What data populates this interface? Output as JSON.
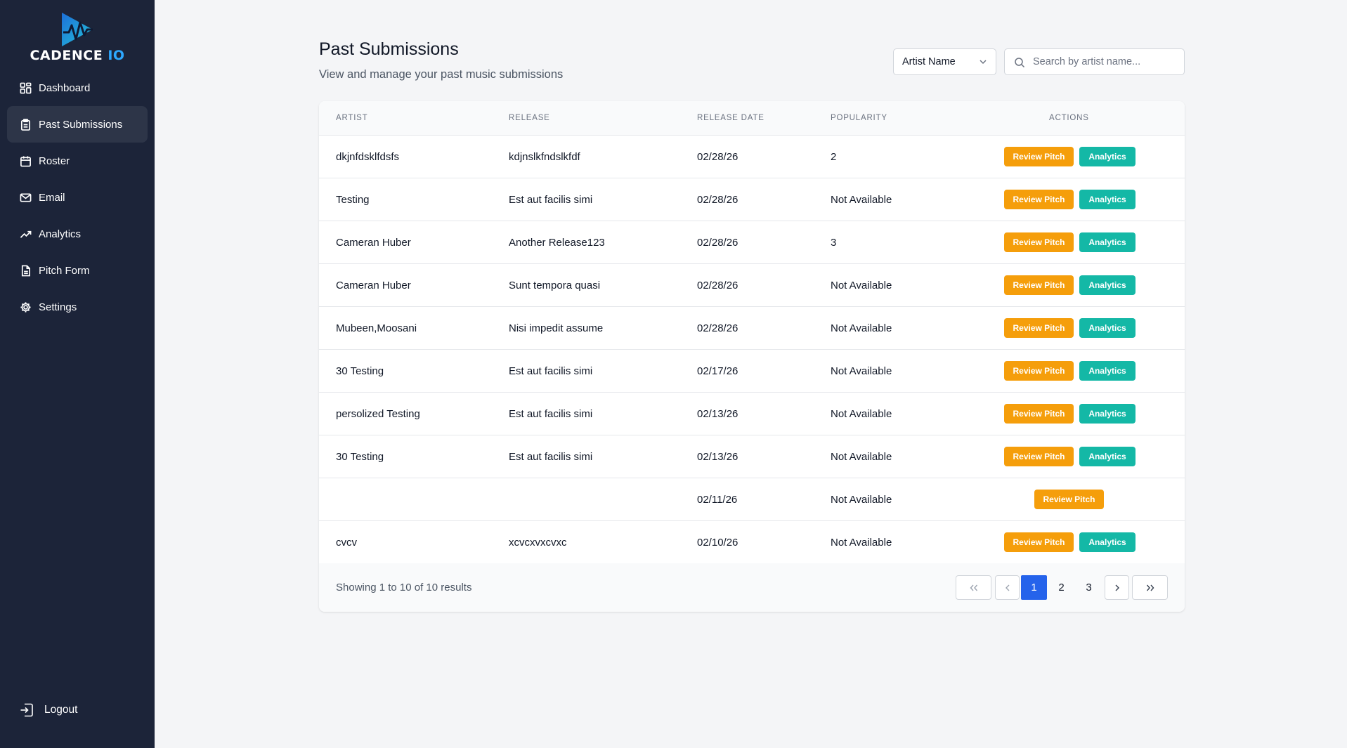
{
  "brand": {
    "name_main": "CADENCE",
    "name_suffix": "IO"
  },
  "sidebar": {
    "items": [
      {
        "label": "Dashboard",
        "icon": "dashboard-grid-icon",
        "active": false
      },
      {
        "label": "Past Submissions",
        "icon": "clipboard-icon",
        "active": true
      },
      {
        "label": "Roster",
        "icon": "calendar-icon",
        "active": false
      },
      {
        "label": "Email",
        "icon": "mail-icon",
        "active": false
      },
      {
        "label": "Analytics",
        "icon": "trending-up-icon",
        "active": false
      },
      {
        "label": "Pitch Form",
        "icon": "document-icon",
        "active": false
      },
      {
        "label": "Settings",
        "icon": "gear-icon",
        "active": false
      }
    ],
    "logout_label": "Logout"
  },
  "header": {
    "title": "Past Submissions",
    "subtitle": "View and manage your past music submissions"
  },
  "filters": {
    "field_select_value": "Artist Name",
    "search_placeholder": "Search by artist name..."
  },
  "table": {
    "columns": [
      "Artist",
      "Release",
      "Release Date",
      "Popularity",
      "Actions"
    ],
    "rows": [
      {
        "artist": "dkjnfdsklfdsfs",
        "release": "kdjnslkfndslkfdf",
        "date": "02/28/26",
        "popularity": "2",
        "review": "Review Pitch",
        "analytics": "Analytics"
      },
      {
        "artist": "Testing",
        "release": "Est aut facilis simi",
        "date": "02/28/26",
        "popularity": "Not Available",
        "review": "Review Pitch",
        "analytics": "Analytics"
      },
      {
        "artist": "Cameran Huber",
        "release": "Another Release123",
        "date": "02/28/26",
        "popularity": "3",
        "review": "Review Pitch",
        "analytics": "Analytics"
      },
      {
        "artist": "Cameran Huber",
        "release": "Sunt tempora quasi",
        "date": "02/28/26",
        "popularity": "Not Available",
        "review": "Review Pitch",
        "analytics": "Analytics"
      },
      {
        "artist": "Mubeen,Moosani",
        "release": "Nisi impedit assume",
        "date": "02/28/26",
        "popularity": "Not Available",
        "review": "Review Pitch",
        "analytics": "Analytics"
      },
      {
        "artist": "30 Testing",
        "release": "Est aut facilis simi",
        "date": "02/17/26",
        "popularity": "Not Available",
        "review": "Review Pitch",
        "analytics": "Analytics"
      },
      {
        "artist": "persolized Testing",
        "release": "Est aut facilis simi",
        "date": "02/13/26",
        "popularity": "Not Available",
        "review": "Review Pitch",
        "analytics": "Analytics"
      },
      {
        "artist": "30 Testing",
        "release": "Est aut facilis simi",
        "date": "02/13/26",
        "popularity": "Not Available",
        "review": "Review Pitch",
        "analytics": "Analytics"
      },
      {
        "artist": "",
        "release": "",
        "date": "02/11/26",
        "popularity": "Not Available",
        "review": "Review Pitch",
        "analytics": null
      },
      {
        "artist": "cvcv",
        "release": "xcvcxvxcvxc",
        "date": "02/10/26",
        "popularity": "Not Available",
        "review": "Review Pitch",
        "analytics": "Analytics"
      }
    ]
  },
  "pagination": {
    "showing_text": "Showing 1 to 10 of 10 results",
    "pages": [
      "1",
      "2",
      "3"
    ],
    "current_page": "1"
  },
  "colors": {
    "sidebar_bg": "#1c2439",
    "review_button": "#f59e0b",
    "analytics_button": "#14b8a6",
    "current_page": "#2563eb",
    "brand_accent": "#2da8ff"
  }
}
